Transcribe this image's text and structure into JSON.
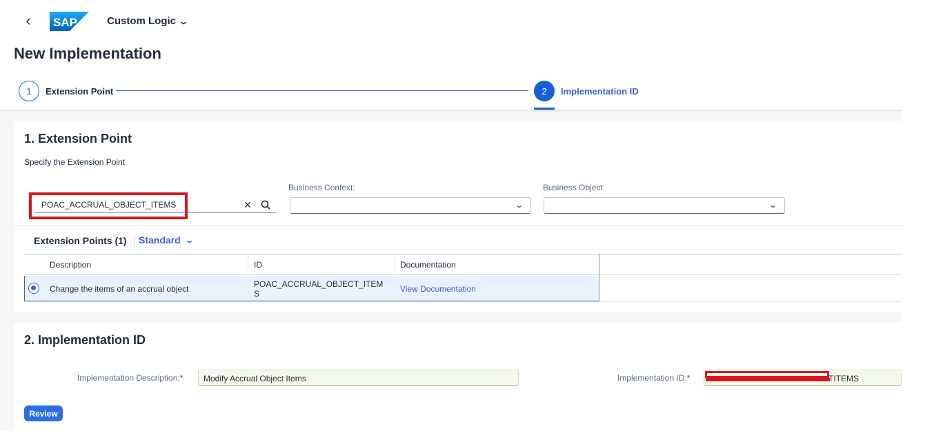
{
  "shellbar": {
    "back_icon": "chevron-left-icon",
    "logo_text": "SAP",
    "app_title": "Custom Logic",
    "app_title_icon": "chevron-down-icon"
  },
  "header": {
    "title": "New Implementation",
    "steps": [
      {
        "number": "1",
        "label": "Extension Point",
        "state": "completed"
      },
      {
        "number": "2",
        "label": "Implementation ID",
        "state": "active"
      }
    ]
  },
  "section1": {
    "title": "1. Extension Point",
    "subtitle": "Specify the Extension Point",
    "search": {
      "value": "POAC_ACCRUAL_OBJECT_ITEMS",
      "clear_icon": "clear-icon",
      "search_icon": "search-icon"
    },
    "business_context": {
      "label": "Business Context:",
      "value": ""
    },
    "business_object": {
      "label": "Business Object:",
      "value": ""
    },
    "table": {
      "title": "Extension Points (1)",
      "variant": "Standard",
      "columns": [
        "Description",
        "ID",
        "Documentation"
      ],
      "rows": [
        {
          "selected": true,
          "description": "Change the items of an accrual object",
          "id_line1": "POAC_ACCRUAL_OBJECT_ITEM",
          "id_line2": "S",
          "documentation": "View Documentation"
        }
      ]
    }
  },
  "section2": {
    "title": "2. Implementation ID",
    "description_label": "Implementation Description:",
    "description_value": "Modify Accrual Object Items",
    "id_label": "Implementation ID:",
    "id_value": "TITEMS",
    "required_mark": "*",
    "review_label": "Review"
  },
  "colors": {
    "accent": "#3a62c9",
    "highlight_red": "#d71920",
    "selected_row": "#e8f2ff",
    "valid_input": "#f3faeb"
  }
}
